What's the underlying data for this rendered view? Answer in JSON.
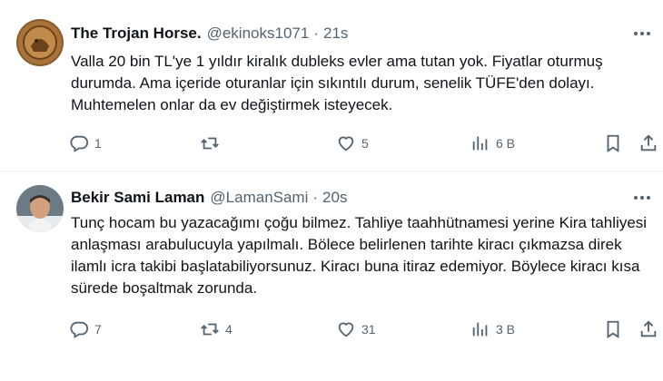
{
  "tweets": [
    {
      "name": "The Trojan Horse.",
      "handle": "@ekinoks1071",
      "time": "21s",
      "text": "Valla 20 bin TL'ye 1 yıldır kiralık dubleks evler ama tutan yok. Fiyatlar oturmuş durumda. Ama içeride oturanlar için sıkıntılı durum, senelik TÜFE'den dolayı. Muhtemelen onlar da ev değiştirmek isteyecek.",
      "replies": "1",
      "retweets": "",
      "likes": "5",
      "views": "6 B"
    },
    {
      "name": "Bekir Sami Laman",
      "handle": "@LamanSami",
      "time": "20s",
      "text": "Tunç hocam bu yazacağımı çoğu bilmez. Tahliye taahhütnamesi yerine Kira tahliyesi anlaşması arabulucuyla yapılmalı. Bölece belirlenen tarihte kiracı çıkmazsa direk ilamlı icra takibi başlatabiliyorsunuz. Kiracı buna itiraz edemiyor. Böylece kiracı kısa sürede boşaltmak zorunda.",
      "replies": "7",
      "retweets": "4",
      "likes": "31",
      "views": "3 B"
    }
  ],
  "colors": {
    "text": "#0f1419",
    "secondary": "#536471",
    "divider": "#eff3f4"
  },
  "icons": [
    "more-icon",
    "reply-icon",
    "retweet-icon",
    "like-icon",
    "views-icon",
    "bookmark-icon",
    "share-icon"
  ]
}
